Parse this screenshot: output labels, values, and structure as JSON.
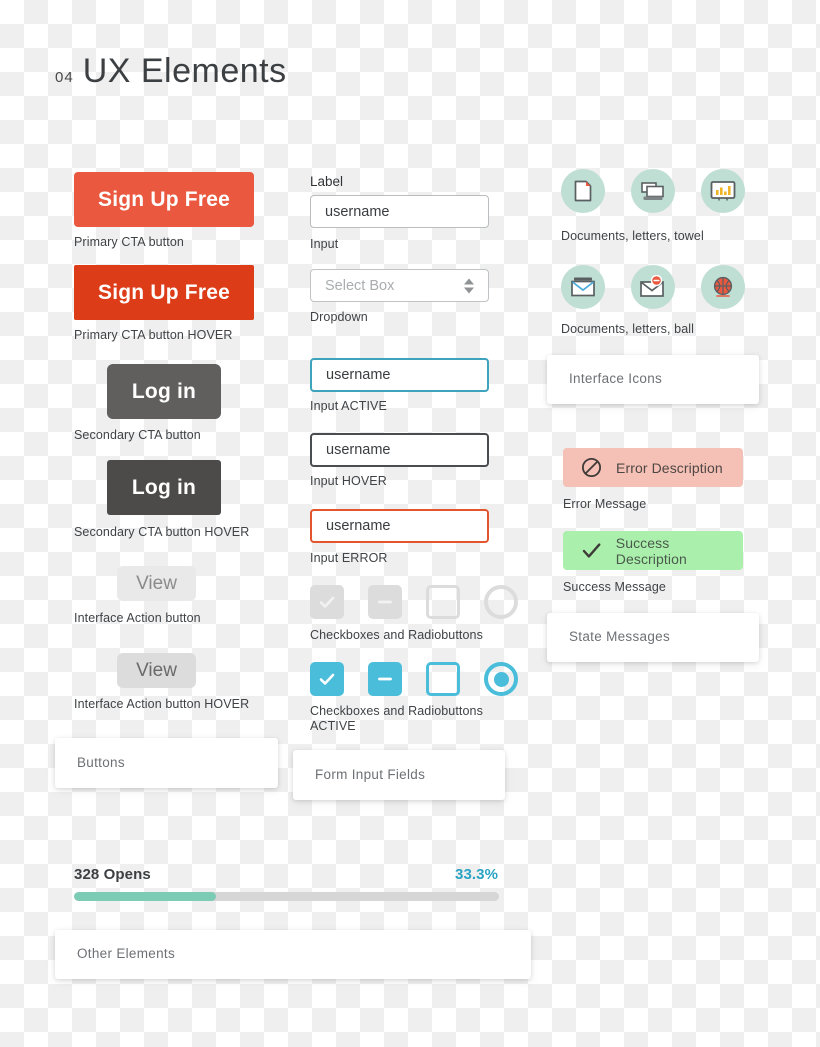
{
  "page": {
    "title_number": "04",
    "title": "UX Elements"
  },
  "buttons_card": {
    "label": "Buttons",
    "items": [
      {
        "text": "Sign Up Free",
        "caption": "Primary CTA button"
      },
      {
        "text": "Sign Up Free",
        "caption": "Primary CTA button HOVER"
      },
      {
        "text": "Log in",
        "caption": "Secondary CTA button"
      },
      {
        "text": "Log in",
        "caption": "Secondary CTA button HOVER"
      },
      {
        "text": "View",
        "caption": "Interface Action button"
      },
      {
        "text": "View",
        "caption": "Interface Action button HOVER"
      }
    ],
    "colors": {
      "primary": "#e9583f",
      "primary_hover": "#dd3c18",
      "secondary": "#605f5e",
      "secondary_hover": "#4c4b4a",
      "interface": "#e9e9e9",
      "interface_hover": "#dcdcdc"
    }
  },
  "form_card": {
    "label": "Form Input Fields",
    "field_label": "Label",
    "fields": [
      {
        "value": "username",
        "placeholder": "username",
        "caption": "Input",
        "state": "normal"
      },
      {
        "value": "",
        "placeholder": "Select Box",
        "caption": "Dropdown",
        "state": "select"
      },
      {
        "value": "username",
        "placeholder": "username",
        "caption": "Input ACTIVE",
        "state": "active"
      },
      {
        "value": "username",
        "placeholder": "username",
        "caption": "Input HOVER",
        "state": "hover"
      },
      {
        "value": "username",
        "placeholder": "username",
        "caption": "Input ERROR",
        "state": "error"
      }
    ],
    "checkbox_rows": [
      {
        "caption": "Checkboxes and Radiobuttons",
        "state": "inactive"
      },
      {
        "caption": "Checkboxes and Radiobuttons\nACTIVE",
        "state": "active"
      }
    ],
    "colors": {
      "active_border": "#3ea3bd",
      "hover_border": "#4a4d50",
      "error_border": "#e2552f",
      "checkbox_active": "#49bdda",
      "checkbox_inactive": "#dcdcdc"
    }
  },
  "icons_card": {
    "label": "Interface Icons",
    "rows": [
      {
        "caption": "Documents, letters, towel",
        "icons": [
          "document-icon",
          "letters-stack-icon",
          "chart-monitor-icon"
        ]
      },
      {
        "caption": "Documents, letters, ball",
        "icons": [
          "open-envelope-icon",
          "envelope-notification-icon",
          "basketball-icon"
        ]
      }
    ],
    "circle_color": "#bfded4"
  },
  "messages_card": {
    "label": "State Messages",
    "messages": [
      {
        "text": "Error Description",
        "caption": "Error Message",
        "icon": "prohibition-icon",
        "bg": "#f5c0b5"
      },
      {
        "text": "Success Description",
        "caption": "Success Message",
        "icon": "check-icon",
        "bg": "#abefac"
      }
    ]
  },
  "other_card": {
    "label": "Other Elements",
    "progress": {
      "title": "328 Opens",
      "percent_label": "33.3%",
      "percent_value": 33.3,
      "fill_color": "#7ccbb5",
      "track_color": "#d6d6d6",
      "percent_text_color": "#2aa3c4"
    }
  }
}
